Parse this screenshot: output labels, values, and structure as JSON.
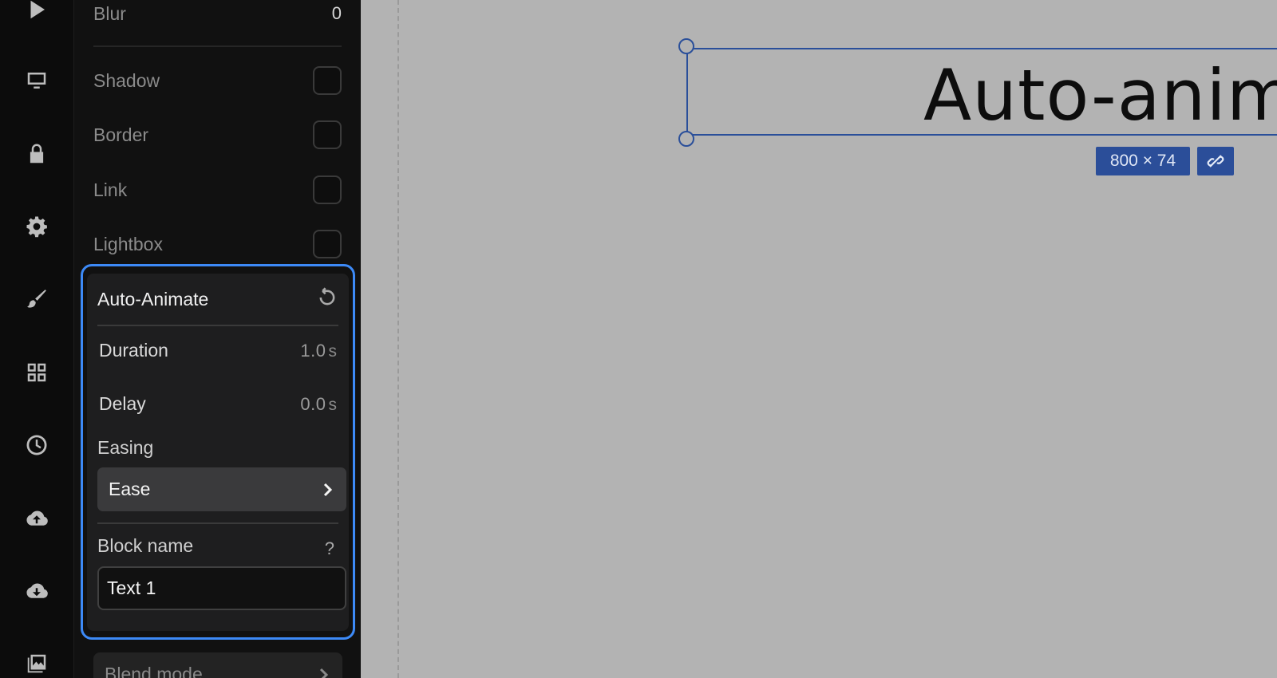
{
  "settings": {
    "blur": {
      "label": "Blur",
      "value": "0"
    },
    "shadow": {
      "label": "Shadow"
    },
    "border": {
      "label": "Border"
    },
    "link": {
      "label": "Link"
    },
    "lightbox": {
      "label": "Lightbox"
    }
  },
  "auto_animate": {
    "title": "Auto-Animate",
    "duration": {
      "label": "Duration",
      "value": "1.0",
      "unit": "s"
    },
    "delay": {
      "label": "Delay",
      "value": "0.0",
      "unit": "s"
    },
    "easing": {
      "label": "Easing",
      "value": "Ease"
    },
    "block_name": {
      "label": "Block name",
      "help": "?",
      "value": "Text 1"
    }
  },
  "blend_mode": {
    "label": "Blend mode"
  },
  "canvas": {
    "text": "Auto-anim",
    "dimensions": "800 × 74"
  },
  "rail_icons": [
    "play-icon",
    "monitor-icon",
    "lock-icon",
    "gear-icon",
    "brush-icon",
    "grid-icon",
    "clock-icon",
    "cloud-upload-icon",
    "cloud-download-icon",
    "images-icon"
  ],
  "colors": {
    "accent": "#3d8af7",
    "selection": "#2b4e99"
  }
}
